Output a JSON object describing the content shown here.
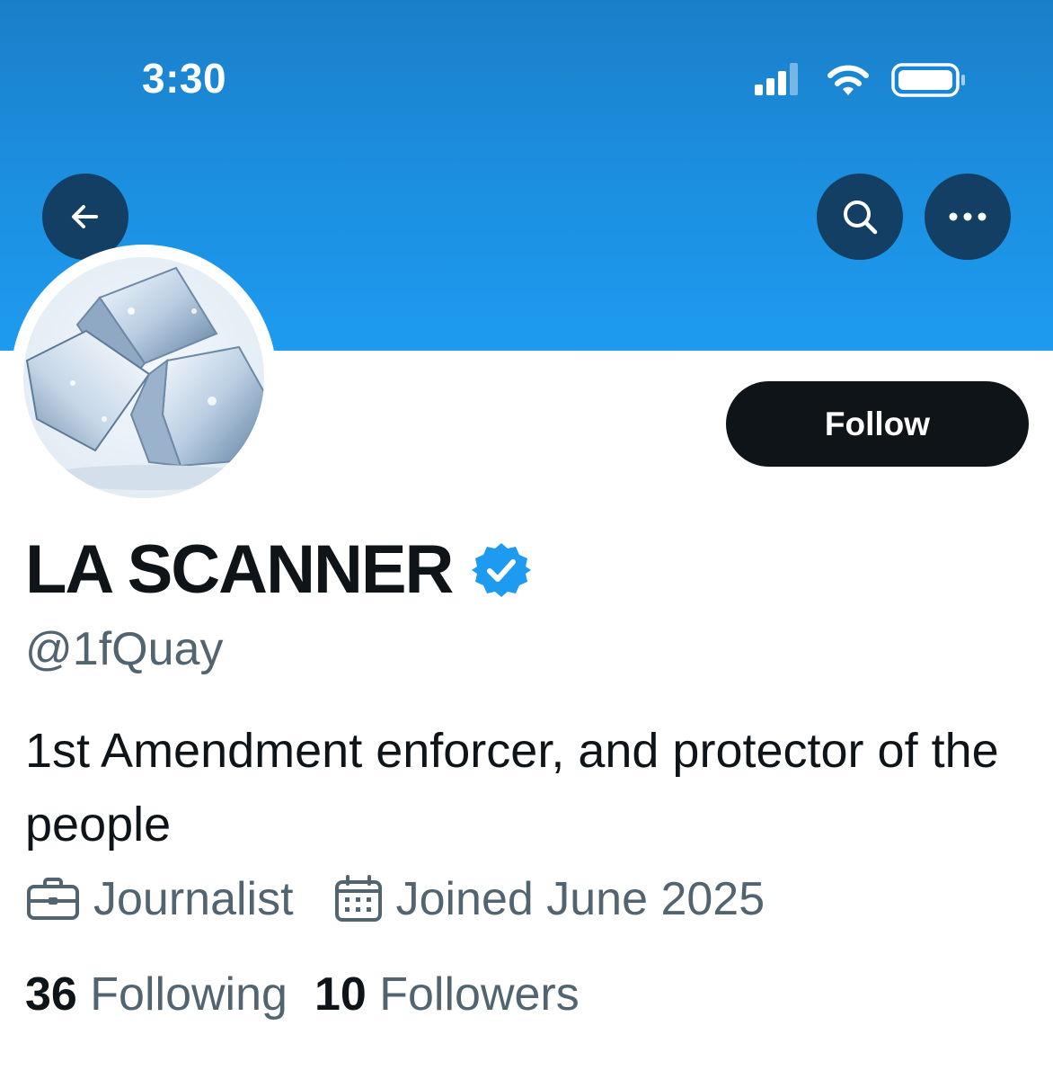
{
  "status_bar": {
    "time": "3:30",
    "icons": [
      "signal-icon",
      "wifi-icon",
      "battery-icon"
    ]
  },
  "header": {
    "back_icon": "arrow-left-icon",
    "search_icon": "search-icon",
    "more_icon": "more-horizontal-icon",
    "banner_color": "#1d9bf0"
  },
  "profile": {
    "avatar_description": "ice-cubes-avatar",
    "follow_label": "Follow",
    "display_name": "LA SCANNER",
    "verified_icon": "verified-badge-icon",
    "handle": "@1fQuay",
    "bio": "1st Amendment enforcer, and protector of the people",
    "category": "Journalist",
    "category_icon": "briefcase-icon",
    "joined": "Joined June 2025",
    "joined_icon": "calendar-icon",
    "following_count": "36",
    "following_label": "Following",
    "followers_count": "10",
    "followers_label": "Followers"
  },
  "colors": {
    "accent": "#1d9bf0",
    "text_primary": "#0f1419",
    "text_secondary": "#536471",
    "button_dark": "#0f1419",
    "header_button": "#123f63"
  }
}
